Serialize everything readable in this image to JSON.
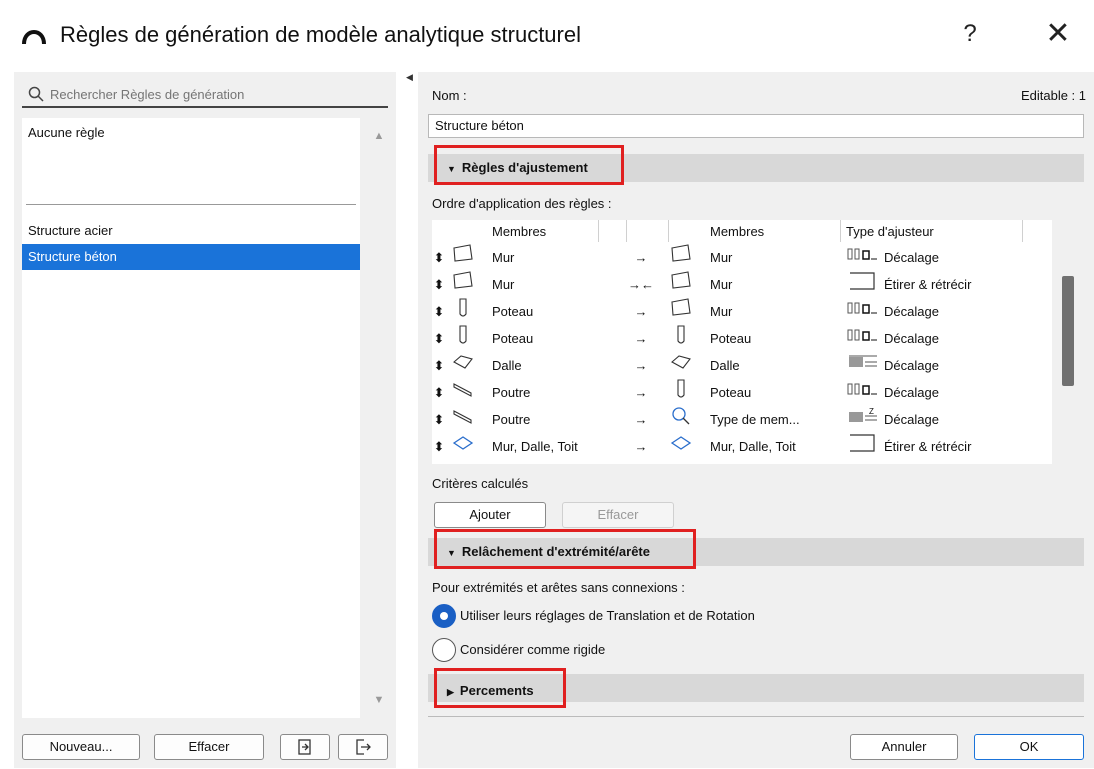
{
  "window": {
    "title": "Règles de génération de modèle analytique structurel",
    "help_label": "?",
    "close_label": "✕"
  },
  "left": {
    "search_placeholder": "Rechercher Règles de génération",
    "items": [
      {
        "label": "Aucune règle"
      },
      {
        "label": "Structure acier"
      },
      {
        "label": "Structure béton",
        "selected": true
      }
    ],
    "buttons": {
      "new_label": "Nouveau...",
      "delete_label": "Effacer"
    }
  },
  "right": {
    "name_label": "Nom :",
    "editable_label": "Editable : 1",
    "name_value": "Structure béton",
    "section_adjust": "Règles d'ajustement",
    "order_label": "Ordre d'application des règles :",
    "table": {
      "headers": [
        "Membres",
        "Membres",
        "Type d'ajusteur"
      ],
      "rows": [
        {
          "left": "Mur",
          "arrow": "→",
          "right": "Mur",
          "adjuster": "Décalage",
          "left_icon": "wall-icon",
          "right_icon": "wall-icon",
          "adj_icon": "offset-icon"
        },
        {
          "left": "Mur",
          "arrow": "→←",
          "right": "Mur",
          "adjuster": "Étirer & rétrécir",
          "left_icon": "wall-icon",
          "right_icon": "wall-icon",
          "adj_icon": "stretch-icon"
        },
        {
          "left": "Poteau",
          "arrow": "→",
          "right": "Mur",
          "adjuster": "Décalage",
          "left_icon": "column-icon",
          "right_icon": "wall-icon",
          "adj_icon": "offset-icon"
        },
        {
          "left": "Poteau",
          "arrow": "→",
          "right": "Poteau",
          "adjuster": "Décalage",
          "left_icon": "column-icon",
          "right_icon": "column-icon",
          "adj_icon": "offset-icon"
        },
        {
          "left": "Dalle",
          "arrow": "→",
          "right": "Dalle",
          "adjuster": "Décalage",
          "left_icon": "slab-icon",
          "right_icon": "slab-icon",
          "adj_icon": "slab-offset-icon"
        },
        {
          "left": "Poutre",
          "arrow": "→",
          "right": "Poteau",
          "adjuster": "Décalage",
          "left_icon": "beam-icon",
          "right_icon": "column-icon",
          "adj_icon": "offset-icon"
        },
        {
          "left": "Poutre",
          "arrow": "→",
          "right": "Type de mem...",
          "adjuster": "Décalage",
          "left_icon": "beam-icon",
          "right_icon": "member-type-icon",
          "adj_icon": "z-offset-icon"
        },
        {
          "left": "Mur, Dalle, Toit",
          "arrow": "→",
          "right": "Mur, Dalle, Toit",
          "adjuster": "Étirer & rétrécir",
          "left_icon": "multi-icon",
          "right_icon": "multi-icon",
          "adj_icon": "stretch-icon"
        }
      ]
    },
    "criteria_label": "Critères calculés",
    "add_label": "Ajouter",
    "clear_label": "Effacer",
    "section_release": "Relâchement d'extrémité/arête",
    "release_label": "Pour extrémités et arêtes sans connexions :",
    "radio_use": "Utiliser leurs réglages de Translation et de Rotation",
    "radio_rigid": "Considérer comme rigide",
    "section_openings": "Percements",
    "cancel_label": "Annuler",
    "ok_label": "OK"
  }
}
